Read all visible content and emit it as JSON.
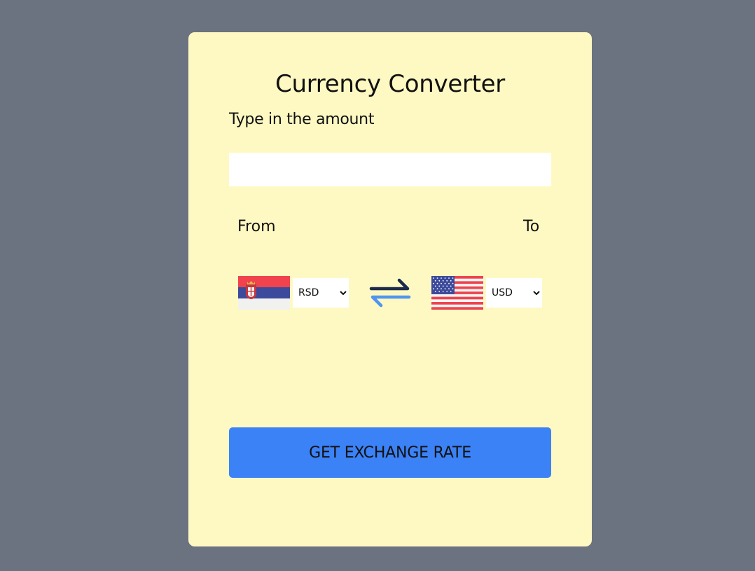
{
  "app": {
    "title": "Currency Converter"
  },
  "amount": {
    "label": "Type in the amount",
    "value": "",
    "placeholder": ""
  },
  "from": {
    "label": "From",
    "currency": "RSD",
    "flag_icon": "serbia-flag-icon"
  },
  "to": {
    "label": "To",
    "currency": "USD",
    "flag_icon": "usa-flag-icon"
  },
  "swap": {
    "icon": "swap-arrows-icon"
  },
  "action": {
    "button_label": "GET EXCHANGE RATE"
  },
  "colors": {
    "background": "#6b7280",
    "card": "#fef9c3",
    "button": "#3b82f6",
    "swap_dark": "#1e2a4a",
    "swap_light": "#4f95f0"
  }
}
